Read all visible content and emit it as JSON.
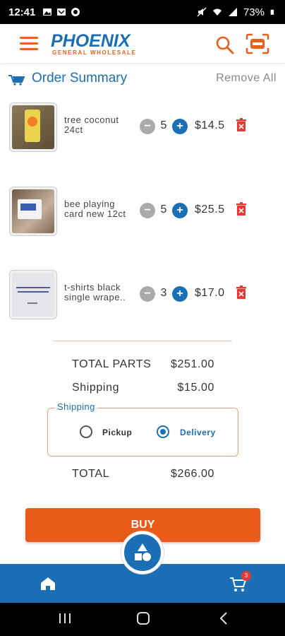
{
  "status_bar": {
    "time": "12:41",
    "battery": "73%",
    "icons": [
      "photo-icon",
      "mail-icon",
      "whatsapp-icon",
      "mute-icon",
      "wifi-icon",
      "signal-icon",
      "battery-icon"
    ]
  },
  "header": {
    "logo_main": "PHOENIX",
    "logo_sub": "GENERAL WHOLESALE",
    "icons": [
      "menu-icon",
      "search-icon",
      "scan-icon"
    ]
  },
  "summary": {
    "title": "Order Summary",
    "remove_all": "Remove All"
  },
  "items": [
    {
      "name": "tree coconut 24ct",
      "qty": "5",
      "price": "$14.5"
    },
    {
      "name": "bee playing card new 12ct",
      "qty": "5",
      "price": "$25.5"
    },
    {
      "name": "t-shirts black single wrape..",
      "qty": "3",
      "price": "$17.0"
    }
  ],
  "controls": {
    "minus": "−",
    "plus": "+"
  },
  "totals": {
    "parts_label": "TOTAL PARTS",
    "parts_value": "$251.00",
    "shipping_label": "Shipping",
    "shipping_value": "$15.00",
    "total_label": "TOTAL",
    "total_value": "$266.00"
  },
  "shipping_options": {
    "legend": "Shipping",
    "pickup": "Pickup",
    "delivery": "Delivery",
    "selected": "Delivery"
  },
  "buy_label": "BUY",
  "bottom_nav": {
    "cart_badge": "3",
    "icons": [
      "home-icon",
      "shapes-icon",
      "cart-icon"
    ]
  },
  "colors": {
    "brand_blue": "#1b6fb5",
    "brand_orange": "#ea5b1a",
    "delete_red": "#e53935"
  }
}
